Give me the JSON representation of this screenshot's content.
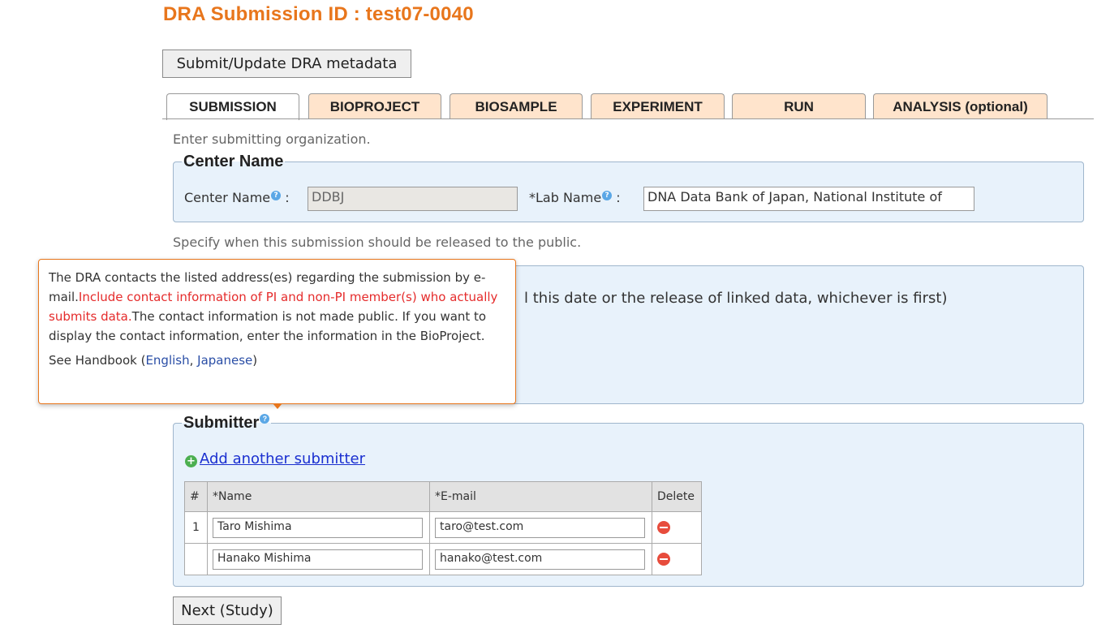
{
  "page": {
    "title": "DRA Submission ID : test07-0040"
  },
  "buttons": {
    "submit_update": "Submit/Update DRA metadata",
    "next": "Next (Study)"
  },
  "tabs": [
    {
      "label": "SUBMISSION",
      "active": true
    },
    {
      "label": "BIOPROJECT",
      "active": false
    },
    {
      "label": "BIOSAMPLE",
      "active": false
    },
    {
      "label": "EXPERIMENT",
      "active": false
    },
    {
      "label": "RUN",
      "active": false
    },
    {
      "label": "ANALYSIS (optional)",
      "active": false
    }
  ],
  "center": {
    "hint": "Enter submitting organization.",
    "legend": "Center Name",
    "center_label": "Center Name",
    "center_value": "DDBJ",
    "lab_label": "*Lab Name",
    "lab_value": "DNA Data Bank of Japan, National Institute of",
    "colon": ":"
  },
  "release": {
    "hint": "Specify when this submission should be released to the public.",
    "text_visible": "l this date or the release of linked data, whichever is first)"
  },
  "submitter": {
    "legend": "Submitter",
    "add_link": "Add another submitter",
    "columns": [
      "#",
      "*Name",
      "*E-mail",
      "Delete"
    ],
    "rows": [
      {
        "num": "1",
        "name": "Taro Mishima",
        "email": "taro@test.com"
      },
      {
        "num": "",
        "name": "Hanako Mishima",
        "email": "hanako@test.com"
      }
    ]
  },
  "tooltip": {
    "part1": "The DRA contacts the listed address(es) regarding the submission by e-mail.",
    "part_red": "Include contact information of PI and non-PI member(s) who actually submits data.",
    "part2": "The contact information is not made public. If you want to display the contact information, enter the information in the BioProject.",
    "see_prefix": "See Handbook (",
    "link_english": "English",
    "sep": ", ",
    "link_japanese": "Japanese",
    "see_suffix": ")"
  },
  "icons": {
    "info": "question-icon",
    "add": "plus-circle-icon",
    "delete": "minus-circle-icon"
  },
  "colors": {
    "title": "#e8761c",
    "tab_bg": "#ffe4cc",
    "box_bg": "#e8f2fb",
    "link": "#1a2fd0",
    "tooltip_border": "#e8761c",
    "red_text": "#e52b2b"
  }
}
